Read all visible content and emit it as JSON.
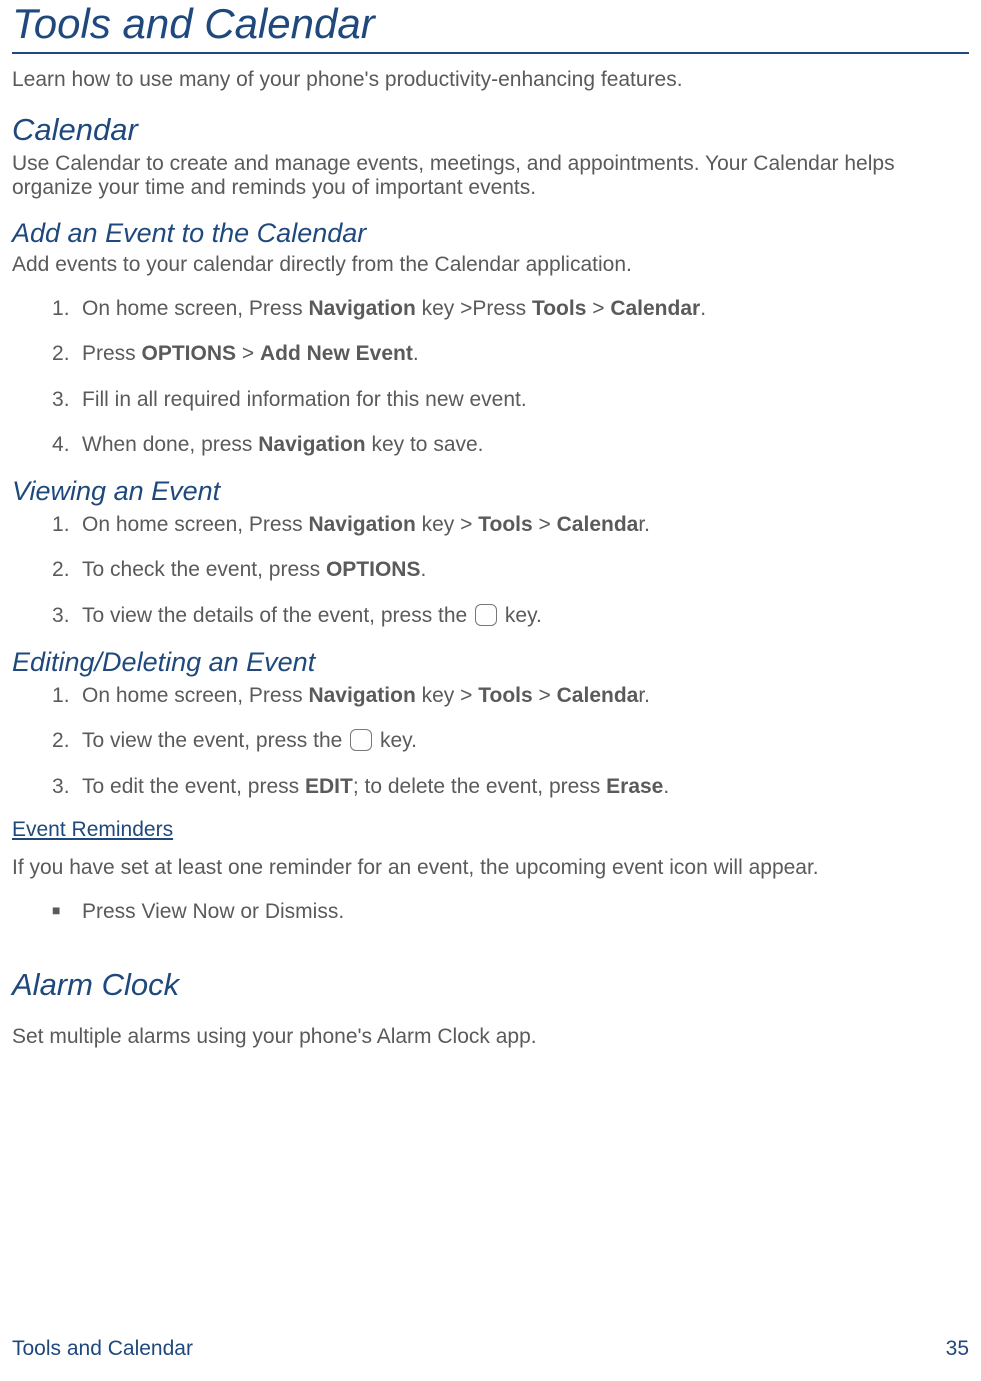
{
  "page": {
    "title": "Tools and Calendar",
    "intro": "Learn how to use many of your phone's productivity-enhancing features."
  },
  "sections": {
    "calendar": {
      "heading": "Calendar",
      "description": "Use Calendar to create and manage events, meetings, and appointments. Your Calendar helps organize your time and reminds you of important events."
    },
    "addEvent": {
      "heading": "Add an Event to the Calendar",
      "description": "Add events to your calendar directly from the Calendar application.",
      "steps": {
        "1": {
          "pre": "On home screen, Press ",
          "b1": "Navigation",
          "mid1": " key >Press ",
          "b2": "Tools",
          "mid2": " > ",
          "b3": "Calendar",
          "post": "."
        },
        "2": {
          "pre": "Press ",
          "b1": "OPTIONS",
          "mid1": " > ",
          "b2": "Add New Event",
          "post": "."
        },
        "3": {
          "text": "Fill in all required information for this new event."
        },
        "4": {
          "pre": "When done, press ",
          "b1": "Navigation",
          "post": " key to save."
        }
      }
    },
    "viewing": {
      "heading": "Viewing an Event",
      "steps": {
        "1": {
          "pre": "On home screen, Press ",
          "b1": "Navigation",
          "mid1": " key > ",
          "b2": "Tools",
          "mid2": " > ",
          "b3": "Calenda",
          "post": "r."
        },
        "2": {
          "pre": "To check the event, press ",
          "b1": "OPTIONS",
          "post": "."
        },
        "3": {
          "pre": "To view the details of the event, press the ",
          "post": " key."
        }
      }
    },
    "editing": {
      "heading": "Editing/Deleting an Event",
      "steps": {
        "1": {
          "pre": "On home screen, Press ",
          "b1": "Navigation",
          "mid1": " key > ",
          "b2": "Tools",
          "mid2": " > ",
          "b3": "Calenda",
          "post": "r."
        },
        "2": {
          "pre": "To view the event, press the ",
          "post": " key."
        },
        "3": {
          "pre": "To edit the event, press ",
          "b1": "EDIT",
          "mid1": "; to delete the event, press ",
          "b2": "Erase",
          "post": "."
        }
      }
    },
    "reminders": {
      "heading": "Event Reminders",
      "description": "If you have set at least one reminder for an event, the upcoming event icon will appear.",
      "bullet": "Press View Now or Dismiss."
    },
    "alarm": {
      "heading": "Alarm Clock",
      "description": "Set multiple alarms using your phone's Alarm Clock app."
    }
  },
  "footer": {
    "left": "Tools and Calendar",
    "right": "35"
  }
}
